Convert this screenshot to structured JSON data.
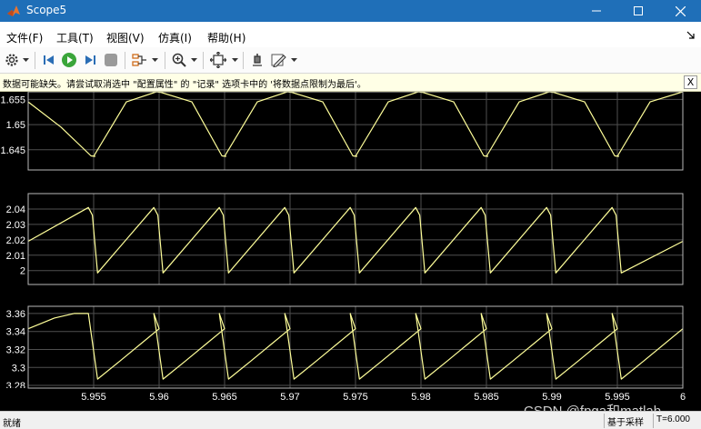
{
  "window": {
    "title": "Scope5"
  },
  "menu": {
    "items": [
      "文件(F)",
      "工具(T)",
      "视图(V)",
      "仿真(I)",
      "帮助(H)"
    ]
  },
  "toolbar": {
    "icons": [
      "settings-gear-icon",
      "dropdown-arrow-icon",
      "step-back-icon",
      "run-icon",
      "step-forward-icon",
      "stop-icon",
      "signal-select-icon",
      "zoom-in-icon",
      "fit-to-view-icon",
      "highlight-block-icon",
      "style-pen-icon"
    ]
  },
  "infobar": {
    "message": "数据可能缺失。请尝试取消选中 \"配置属性\" 的 \"记录\" 选项卡中的 '将数据点限制为最后'。",
    "close_label": "X"
  },
  "colors": {
    "signal": "#ffff9a",
    "grid": "#4f4f4f",
    "axis_bg": "#000000",
    "titlebar": "#1f6fb8"
  },
  "chart_data": [
    {
      "type": "line",
      "title": "",
      "xlabel": "",
      "ylabel": "",
      "xlim": [
        5.95,
        6.0
      ],
      "ylim": [
        1.641,
        1.6565
      ],
      "yticks": [
        "1.655",
        "1.65",
        "1.645"
      ],
      "ytick_values": [
        1.655,
        1.65,
        1.645
      ],
      "grid": true,
      "series": [
        {
          "x": [
            5.95,
            5.9525,
            5.9548,
            5.9551,
            5.955,
            5.9575,
            5.9598,
            5.9601,
            5.96,
            5.9625,
            5.9648,
            5.9651,
            5.965,
            5.9675,
            5.9698,
            5.9701,
            5.97,
            5.9725,
            5.9748,
            5.9751,
            5.975,
            5.9775,
            5.9798,
            5.9801,
            5.98,
            5.9825,
            5.9848,
            5.9851,
            5.985,
            5.9875,
            5.9898,
            5.9901,
            5.99,
            5.9925,
            5.9948,
            5.9951,
            5.995,
            5.9975,
            6.0
          ],
          "values": [
            1.6545,
            1.6495,
            1.6438,
            1.6437,
            1.6437,
            1.6545,
            1.6565,
            1.6564,
            1.6565,
            1.6545,
            1.6438,
            1.6437,
            1.6437,
            1.6545,
            1.6565,
            1.6564,
            1.6565,
            1.6545,
            1.6438,
            1.6437,
            1.6437,
            1.6545,
            1.6565,
            1.6564,
            1.6565,
            1.6545,
            1.6438,
            1.6437,
            1.6437,
            1.6545,
            1.6565,
            1.6564,
            1.6565,
            1.6545,
            1.6438,
            1.6437,
            1.6437,
            1.6545,
            1.6565
          ]
        }
      ]
    },
    {
      "type": "line",
      "title": "",
      "xlabel": "",
      "ylabel": "",
      "xlim": [
        5.95,
        6.0
      ],
      "ylim": [
        1.991,
        2.05
      ],
      "yticks": [
        "2.04",
        "2.03",
        "2.02",
        "2.01",
        "2"
      ],
      "ytick_values": [
        2.04,
        2.03,
        2.02,
        2.01,
        2.0
      ],
      "grid": true,
      "series": [
        {
          "x": [
            5.95,
            5.9546,
            5.9549,
            5.9553,
            5.9596,
            5.9599,
            5.9603,
            5.9646,
            5.9649,
            5.9653,
            5.9696,
            5.9699,
            5.9703,
            5.9746,
            5.9749,
            5.9753,
            5.9796,
            5.9799,
            5.9803,
            5.9846,
            5.9849,
            5.9853,
            5.9896,
            5.9899,
            5.9903,
            5.9946,
            5.9949,
            5.9953,
            6.0
          ],
          "values": [
            2.019,
            2.041,
            2.036,
            1.9985,
            2.041,
            2.036,
            1.9985,
            2.041,
            2.036,
            1.9985,
            2.041,
            2.036,
            1.9985,
            2.041,
            2.036,
            1.9985,
            2.041,
            2.036,
            1.9985,
            2.041,
            2.036,
            1.9985,
            2.041,
            2.036,
            1.9985,
            2.041,
            2.036,
            1.9985,
            2.019
          ]
        }
      ]
    },
    {
      "type": "line",
      "title": "",
      "xlabel": "",
      "ylabel": "",
      "xlim": [
        5.95,
        6.0
      ],
      "ylim": [
        3.277,
        3.368
      ],
      "yticks": [
        "3.36",
        "3.34",
        "3.32",
        "3.3",
        "3.28"
      ],
      "ytick_values": [
        3.36,
        3.34,
        3.32,
        3.3,
        3.28
      ],
      "grid": true,
      "series": [
        {
          "x": [
            5.95,
            5.952,
            5.9535,
            5.9546,
            5.9553,
            5.957,
            5.9585,
            5.96,
            5.9596,
            5.9603,
            5.962,
            5.9635,
            5.965,
            5.9646,
            5.9653,
            5.967,
            5.9685,
            5.97,
            5.9696,
            5.9703,
            5.972,
            5.9735,
            5.975,
            5.9746,
            5.9753,
            5.977,
            5.9785,
            5.98,
            5.9796,
            5.9803,
            5.982,
            5.9835,
            5.985,
            5.9846,
            5.9853,
            5.987,
            5.9885,
            5.99,
            5.9896,
            5.9903,
            5.992,
            5.9935,
            5.995,
            5.9946,
            5.9953,
            5.997,
            6.0
          ],
          "values": [
            3.343,
            3.355,
            3.36,
            3.36,
            3.287,
            3.307,
            3.325,
            3.343,
            3.36,
            3.287,
            3.307,
            3.325,
            3.343,
            3.36,
            3.287,
            3.307,
            3.325,
            3.343,
            3.36,
            3.287,
            3.307,
            3.325,
            3.343,
            3.36,
            3.287,
            3.307,
            3.325,
            3.343,
            3.36,
            3.287,
            3.307,
            3.325,
            3.343,
            3.36,
            3.287,
            3.307,
            3.325,
            3.343,
            3.36,
            3.287,
            3.307,
            3.325,
            3.343,
            3.36,
            3.287,
            3.307,
            3.343
          ]
        }
      ]
    }
  ],
  "x_axis": {
    "ticks": [
      "5.955",
      "5.96",
      "5.965",
      "5.97",
      "5.975",
      "5.98",
      "5.985",
      "5.99",
      "5.995",
      "6"
    ],
    "tick_values": [
      5.955,
      5.96,
      5.965,
      5.97,
      5.975,
      5.98,
      5.985,
      5.99,
      5.995,
      6.0
    ]
  },
  "statusbar": {
    "ready": "就绪",
    "sample": "基于采样",
    "time": "T=6.000"
  },
  "watermark": "CSDN @fpga和matlab"
}
